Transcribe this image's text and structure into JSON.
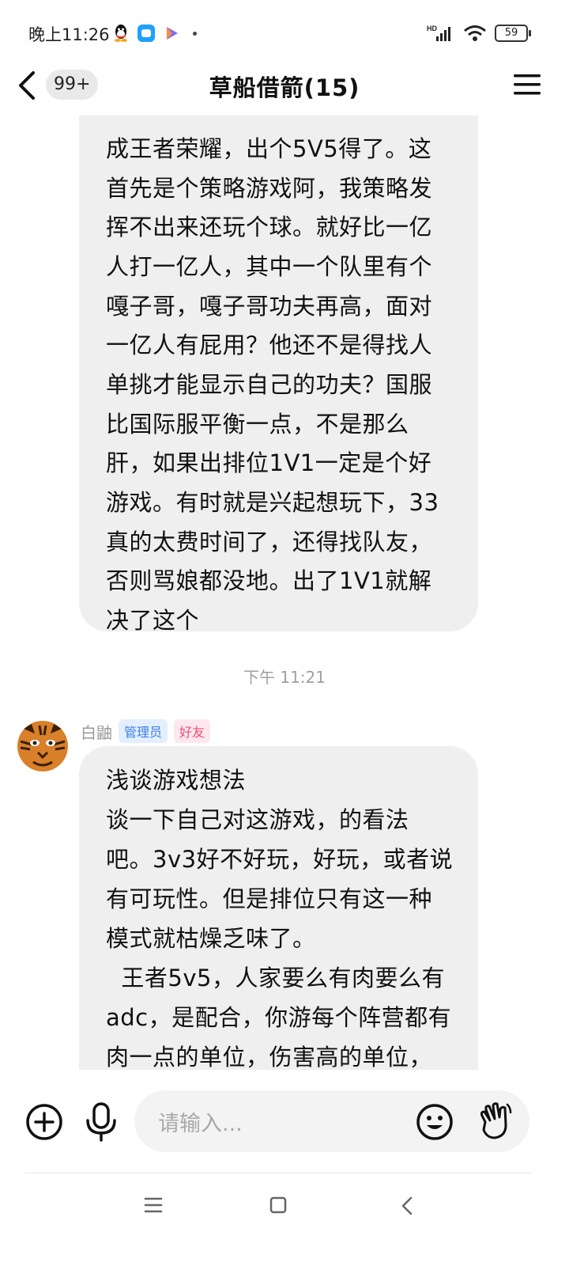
{
  "status_bar": {
    "time": "晚上11:26",
    "network": "HD",
    "battery": "59"
  },
  "header": {
    "unread_badge": "99+",
    "title": "草船借箭(15)"
  },
  "messages": [
    {
      "lines": [
        "成王者荣耀，出个5V5得了。这",
        "首先是个策略游戏阿，我策略发",
        "挥不出来还玩个球。就好比一亿",
        "人打一亿人，其中一个队里有个",
        "嘎子哥，嘎子哥功夫再高，面对",
        "一亿人有屁用？他还不是得找人",
        "单挑才能显示自己的功夫？国服",
        "比国际服平衡一点，不是那么",
        "肝，如果出排位1V1一定是个好",
        "游戏。有时就是兴起想玩下，33",
        "真的太费时间了，还得找队友，",
        "否则骂娘都没地。出了1V1就解",
        "决了这个"
      ]
    },
    {
      "timestamp": "下午 11:21",
      "sender": "白鼬",
      "tags": [
        "管理员",
        "好友"
      ],
      "lines": [
        "浅谈游戏想法",
        "谈一下自己对这游戏，的看法",
        "吧。3v3好不好玩，好玩，或者说",
        "有可玩性。但是排位只有这一种",
        "模式就枯燥乏味了。",
        "  王者5v5，人家要么有肉要么有",
        "adc，是配合，你游每个阵营都有",
        "肉一点的单位，伤害高的单位，"
      ]
    }
  ],
  "input": {
    "placeholder": "请输入..."
  },
  "colors": {
    "bubble": "#efefef",
    "admin_tag": "#3d7fe6",
    "friend_tag": "#ec4f7c"
  },
  "icons": [
    "back-icon",
    "menu-icon",
    "add-icon",
    "mic-icon",
    "emoji-icon",
    "wave-hand-icon",
    "nav-menu-icon",
    "nav-home-icon",
    "nav-back-icon"
  ]
}
